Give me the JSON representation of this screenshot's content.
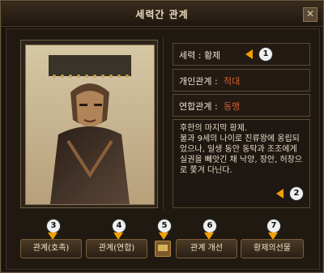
{
  "window": {
    "title": "세력간 관계",
    "close_icon": "close-icon"
  },
  "info": {
    "faction_label": "세력 : 황제",
    "personal_label": "개인관계 : ",
    "personal_value": "적대",
    "alliance_label": "연합관계 : ",
    "alliance_value": "동맹"
  },
  "bio": {
    "headline": "후한의 마지막 황제.",
    "text": "불과 9세의 나이로 진류왕에 옹립되었으나, 일생 동안 동탁과 조조에게 실권을 빼앗긴 채 낙양, 장안, 허창으로 쫓겨 다닌다."
  },
  "buttons": [
    {
      "label": "관계(호족)"
    },
    {
      "label": "관계(연합)"
    },
    {
      "label": "관계 개선"
    },
    {
      "label": "황제의선물"
    }
  ],
  "markers": [
    "1",
    "2",
    "3",
    "4",
    "5",
    "6",
    "7"
  ],
  "colors": {
    "accent": "#f2a000",
    "relation_value": "#d35d2e"
  }
}
